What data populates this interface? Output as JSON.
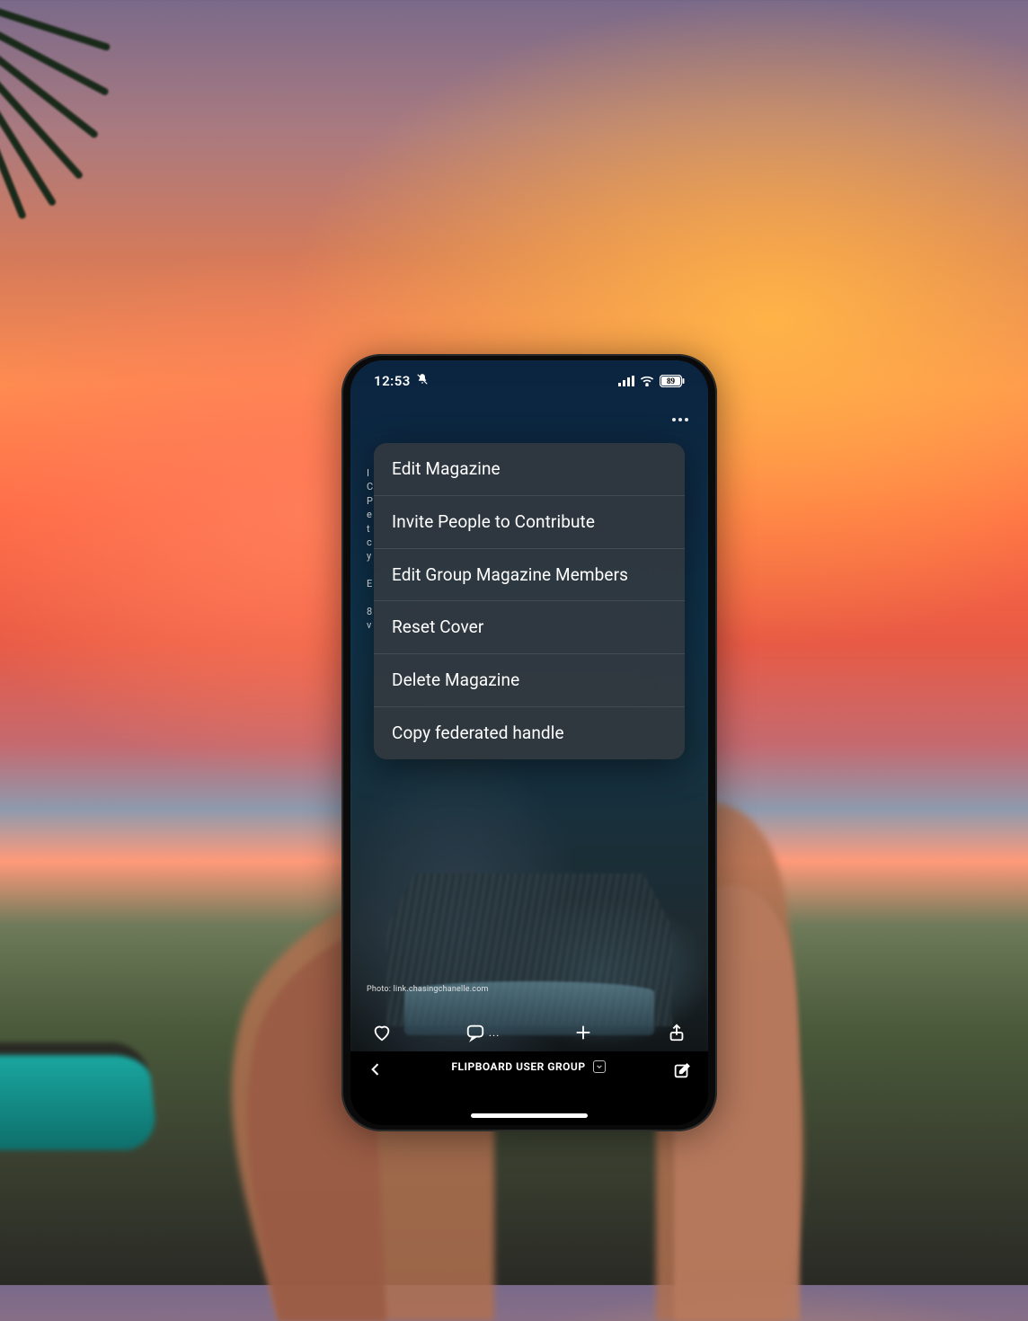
{
  "status_bar": {
    "time": "12:53",
    "silent_icon": "bell-slash-icon",
    "cellular_icon": "cellular-icon",
    "wifi_icon": "wifi-icon",
    "battery_percent": "89"
  },
  "app_header": {
    "more_icon": "more-horizontal-icon"
  },
  "menu": {
    "items": [
      {
        "label": "Edit Magazine"
      },
      {
        "label": "Invite People to Contribute"
      },
      {
        "label": "Edit Group Magazine Members"
      },
      {
        "label": "Reset Cover"
      },
      {
        "label": "Delete Magazine"
      },
      {
        "label": "Copy federated handle"
      }
    ]
  },
  "photo_credit": "Photo: link.chasingchanelle.com",
  "action_bar": {
    "like_icon": "heart-icon",
    "comment_icon": "comment-icon",
    "comment_ellipsis": "...",
    "add_icon": "plus-icon",
    "share_icon": "share-icon"
  },
  "bottom_bar": {
    "back_icon": "back-icon",
    "title": "FLIPBOARD USER GROUP",
    "dropdown_icon": "chevron-down-icon",
    "compose_icon": "compose-icon"
  },
  "background_scene": {
    "description": "Hand holding a smartphone against a sunset sky over ocean and foliage",
    "palm_fronds": true,
    "boat_color": "#1aa7a0"
  }
}
